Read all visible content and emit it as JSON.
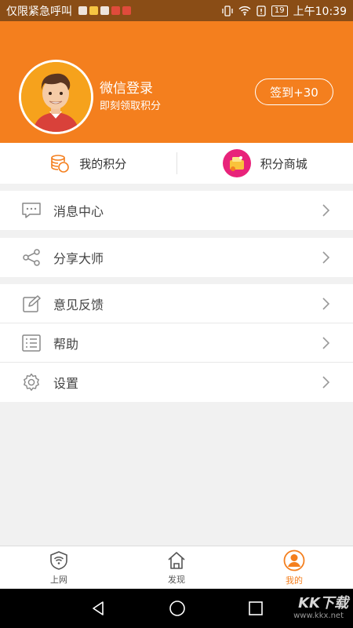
{
  "status_bar": {
    "notice": "仅限紧急呼叫",
    "battery": "19",
    "time": "上午10:39"
  },
  "profile": {
    "login_title": "微信登录",
    "login_subtitle": "即刻领取积分",
    "checkin_label": "签到+30"
  },
  "points_bar": {
    "my_points": "我的积分",
    "points_mall": "积分商城"
  },
  "menu": {
    "messages": "消息中心",
    "share": "分享大师",
    "feedback": "意见反馈",
    "help": "帮助",
    "settings": "设置"
  },
  "tabs": {
    "internet": "上网",
    "discover": "发现",
    "mine": "我的"
  },
  "watermark": {
    "brand": "KK下载",
    "url": "www.kkx.net"
  },
  "colors": {
    "accent": "#f47f1e",
    "status_bar": "#8a4d16"
  }
}
